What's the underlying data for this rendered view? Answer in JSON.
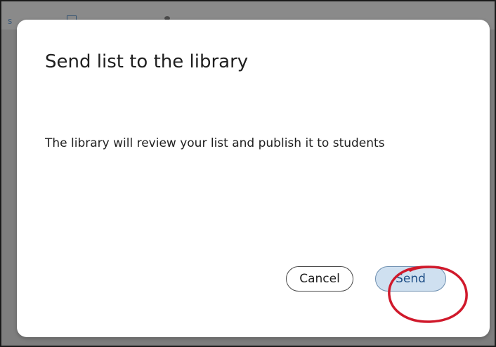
{
  "background_page": {
    "fragment_text": "s"
  },
  "dialog": {
    "title": "Send list to the library",
    "message": "The library will review your list and publish it to students",
    "cancel_label": "Cancel",
    "send_label": "Send"
  },
  "annotation": {
    "highlight_color": "#d0192b",
    "target": "send-button"
  },
  "colors": {
    "send_fill": "#cfe0f0",
    "send_text": "#1e4e86",
    "overlay": "#7e7e7e"
  }
}
